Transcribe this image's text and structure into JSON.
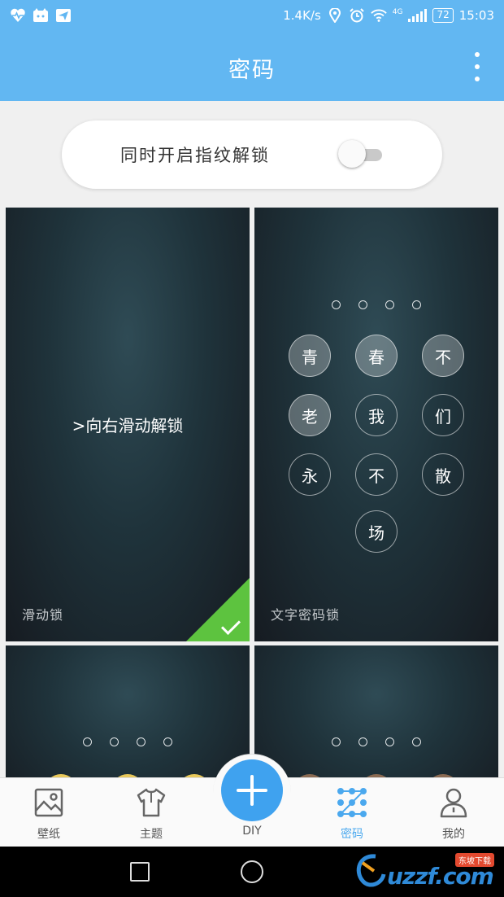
{
  "status_bar": {
    "net_speed": "1.4K/s",
    "network_type": "4G",
    "battery": "72",
    "time": "15:03",
    "left_icons": [
      "heart-pulse-icon",
      "cat-app-icon",
      "send-app-icon"
    ],
    "right_icons": [
      "location-icon",
      "alarm-icon",
      "wifi-icon",
      "signal-icon",
      "battery-icon"
    ]
  },
  "app_bar": {
    "title": "密码",
    "menu_icon": "more-vertical-icon"
  },
  "fingerprint": {
    "label": "同时开启指纹解锁",
    "enabled": false
  },
  "tiles": [
    {
      "name": "滑动锁",
      "preview_text": ">向右滑动解锁",
      "selected": true
    },
    {
      "name": "文字密码锁",
      "dot_count": 4,
      "keys": [
        "青",
        "春",
        "不",
        "老",
        "我",
        "们",
        "永",
        "不",
        "散",
        "场"
      ],
      "lit_keys": [
        "青",
        "春",
        "不",
        "老"
      ]
    },
    {
      "dot_count": 4
    },
    {
      "dot_count": 4
    }
  ],
  "bottom_nav": {
    "items": [
      {
        "label": "壁纸",
        "icon": "wallpaper-icon"
      },
      {
        "label": "主题",
        "icon": "shirt-icon"
      },
      {
        "label": "DIY",
        "icon": "plus-icon"
      },
      {
        "label": "密码",
        "icon": "pattern-grid-icon",
        "active": true
      },
      {
        "label": "我的",
        "icon": "profile-icon"
      }
    ]
  },
  "watermark": {
    "text": "uzzf.com",
    "badge": "东坡下载"
  },
  "colors": {
    "primary": "#62b7f2",
    "accent": "#3fa2ef",
    "check": "#5dc33f"
  }
}
